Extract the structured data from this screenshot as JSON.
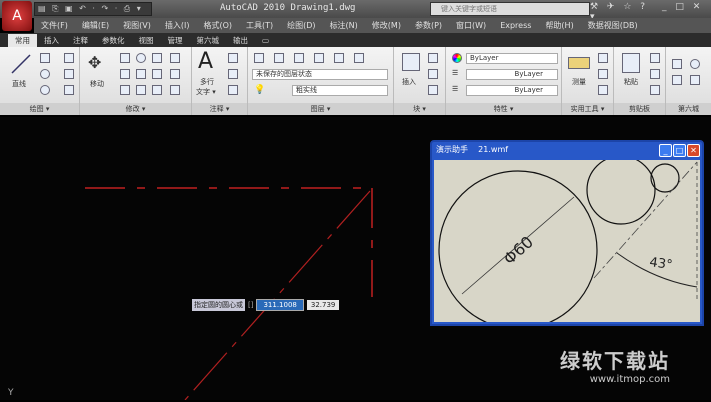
{
  "titlebar": {
    "app_logo": "A",
    "qat": "▤ ⎘ ▣ ↶ · ↷ · ⎙ ▾",
    "title": "AutoCAD 2010  Drawing1.dwg",
    "search_placeholder": "键入关键字或短语",
    "tools": "⚒ ✈ ☆ ? ▾",
    "window_controls": "_ □ ✕"
  },
  "menu": [
    "文件(F)",
    "编辑(E)",
    "视图(V)",
    "插入(I)",
    "格式(O)",
    "工具(T)",
    "绘图(D)",
    "标注(N)",
    "修改(M)",
    "参数(P)",
    "窗口(W)",
    "Express",
    "帮助(H)",
    "数据视图(DB)"
  ],
  "tabs": [
    "常用",
    "插入",
    "注释",
    "参数化",
    "视图",
    "管理",
    "第六城",
    "输出",
    "▭"
  ],
  "ribbon": {
    "panels": [
      "绘图 ▾",
      "修改 ▾",
      "注释 ▾",
      "图层 ▾",
      "块 ▾",
      "特性 ▾",
      "实用工具 ▾",
      "剪贴板",
      "第六城"
    ],
    "draw_line": "直线",
    "modify_move": "移动",
    "annot_text_1": "多行",
    "annot_text_2": "文字 ▾",
    "layer_state": "未保存的图层状态",
    "layer_current": "粗实线",
    "block_insert": "插入",
    "prop_color": "ByLayer",
    "prop_linetype": "ByLayer",
    "prop_lineweight": "ByLayer",
    "util_measure": "测量",
    "clip_paste": "粘贴"
  },
  "dialog": {
    "title": "演示助手",
    "file": "21.wmf",
    "dimension": "Φ60",
    "angle": "43°"
  },
  "command_tooltip": {
    "prompt": "指定圆的圆心或",
    "sep": "[]",
    "value1": "311.1008",
    "value2": "32.739"
  },
  "watermark": {
    "name": "绿软下载站",
    "url": "www.itmop.com"
  },
  "ucs_icon": "Y"
}
